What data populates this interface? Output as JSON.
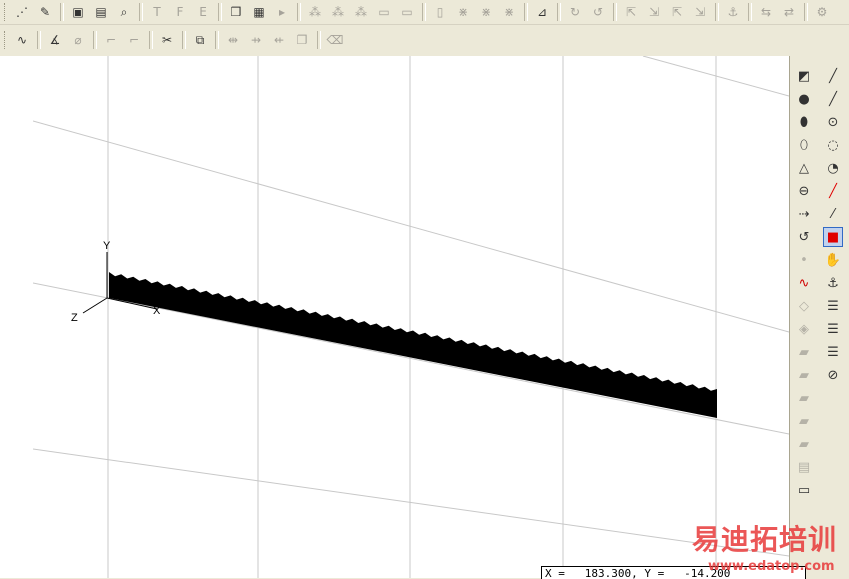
{
  "toolbar1": {
    "buttons": [
      {
        "name": "plot-icon",
        "glyph": "⋰"
      },
      {
        "name": "pin-icon",
        "glyph": "✎"
      },
      {
        "sep": true
      },
      {
        "name": "monitor-icon",
        "glyph": "▣"
      },
      {
        "name": "graph-window-icon",
        "glyph": "▤"
      },
      {
        "name": "search-doc-icon",
        "glyph": "⌕"
      },
      {
        "sep": true
      },
      {
        "name": "tool-t-icon",
        "glyph": "T",
        "dim": true
      },
      {
        "name": "tool-f-icon",
        "glyph": "F",
        "dim": true
      },
      {
        "name": "tool-e-icon",
        "glyph": "E",
        "dim": true
      },
      {
        "sep": true
      },
      {
        "name": "cube-icon",
        "glyph": "❒"
      },
      {
        "name": "save-icon",
        "glyph": "▦"
      },
      {
        "name": "play-icon",
        "glyph": "▸",
        "dim": true
      },
      {
        "sep": true
      },
      {
        "name": "node-icon-1",
        "glyph": "⁂",
        "dim": true
      },
      {
        "name": "node-icon-2",
        "glyph": "⁂",
        "dim": true
      },
      {
        "name": "node-icon-3",
        "glyph": "⁂",
        "dim": true
      },
      {
        "name": "layer-icon-1",
        "glyph": "▭",
        "dim": true
      },
      {
        "name": "layer-icon-2",
        "glyph": "▭",
        "dim": true
      },
      {
        "sep": true
      },
      {
        "name": "page-icon",
        "glyph": "▯",
        "dim": true
      },
      {
        "name": "mesh-icon-1",
        "glyph": "⋇",
        "dim": true
      },
      {
        "name": "mesh-icon-2",
        "glyph": "⋇",
        "dim": true
      },
      {
        "name": "mesh-icon-3",
        "glyph": "⋇",
        "dim": true
      },
      {
        "sep": true
      },
      {
        "name": "coordinate-icon",
        "glyph": "⊿"
      },
      {
        "sep": true
      },
      {
        "name": "rotate-icon-1",
        "glyph": "↻",
        "dim": true
      },
      {
        "name": "rotate-icon-2",
        "glyph": "↺",
        "dim": true
      },
      {
        "sep": true
      },
      {
        "name": "transform-icon-1",
        "glyph": "⇱",
        "dim": true
      },
      {
        "name": "transform-icon-2",
        "glyph": "⇲",
        "dim": true
      },
      {
        "name": "transform-icon-3",
        "glyph": "⇱",
        "dim": true
      },
      {
        "name": "transform-icon-4",
        "glyph": "⇲",
        "dim": true
      },
      {
        "sep": true
      },
      {
        "name": "anchor-small-icon",
        "glyph": "⚓",
        "dim": true
      },
      {
        "sep": true
      },
      {
        "name": "flip-icon-1",
        "glyph": "⇆",
        "dim": true
      },
      {
        "name": "flip-icon-2",
        "glyph": "⇄",
        "dim": true
      },
      {
        "sep": true
      },
      {
        "name": "settings-icon",
        "glyph": "⚙",
        "dim": true
      }
    ]
  },
  "toolbar2": {
    "buttons": [
      {
        "name": "curve-icon",
        "glyph": "∿"
      },
      {
        "sep": true
      },
      {
        "name": "angle-30-icon",
        "glyph": "∡"
      },
      {
        "name": "pipe-icon",
        "glyph": "⌀",
        "dim": true
      },
      {
        "sep": true
      },
      {
        "name": "corner-icon-1",
        "glyph": "⌐",
        "dim": true
      },
      {
        "name": "corner-icon-2",
        "glyph": "⌐",
        "dim": true
      },
      {
        "sep": true
      },
      {
        "name": "scissors-icon",
        "glyph": "✂"
      },
      {
        "sep": true
      },
      {
        "name": "boolean-icon",
        "glyph": "⧉"
      },
      {
        "sep": true
      },
      {
        "name": "mirror-icon-1",
        "glyph": "⇹",
        "dim": true
      },
      {
        "name": "mirror-icon-2",
        "glyph": "⇸",
        "dim": true
      },
      {
        "name": "mirror-icon-3",
        "glyph": "⇷",
        "dim": true
      },
      {
        "name": "copy-icon",
        "glyph": "❐",
        "dim": true
      },
      {
        "sep": true
      },
      {
        "name": "eraser-icon",
        "glyph": "⌫",
        "dim": true
      }
    ]
  },
  "palette": {
    "col1": [
      {
        "name": "plane-icon",
        "glyph": "◩"
      },
      {
        "name": "sphere-icon",
        "glyph": "●"
      },
      {
        "name": "cylinder-icon",
        "glyph": "⬮"
      },
      {
        "name": "cylinder-alt-icon",
        "glyph": "⬯"
      },
      {
        "name": "cone-icon",
        "glyph": "△"
      },
      {
        "name": "ellipse-icon",
        "glyph": "⊖"
      },
      {
        "name": "extrude-icon",
        "glyph": "⇢"
      },
      {
        "name": "revolve-icon",
        "glyph": "↺"
      },
      {
        "name": "point-icon",
        "glyph": "•",
        "dim": true
      },
      {
        "name": "curve-red-icon",
        "glyph": "∿"
      },
      {
        "name": "face-icon-1",
        "glyph": "◇",
        "dim": true
      },
      {
        "name": "face-icon-2",
        "glyph": "◈",
        "dim": true
      },
      {
        "name": "block-icon-1",
        "glyph": "▰",
        "dim": true
      },
      {
        "name": "block-icon-2",
        "glyph": "▰",
        "dim": true
      },
      {
        "name": "block-icon-3",
        "glyph": "▰",
        "dim": true
      },
      {
        "name": "block-icon-4",
        "glyph": "▰",
        "dim": true
      },
      {
        "name": "block-icon-5",
        "glyph": "▰",
        "dim": true
      },
      {
        "name": "doc-icon",
        "glyph": "▤",
        "dim": true
      },
      {
        "name": "folder-icon",
        "glyph": "▭"
      }
    ],
    "col2": [
      {
        "name": "line-icon",
        "glyph": "╱"
      },
      {
        "name": "line-point-icon",
        "glyph": "╱"
      },
      {
        "name": "circle-center-icon",
        "glyph": "⊙"
      },
      {
        "name": "circle-icon",
        "glyph": "◌"
      },
      {
        "name": "arc-icon",
        "glyph": "◔"
      },
      {
        "name": "red-line-icon",
        "glyph": "╱"
      },
      {
        "name": "xy-line-icon",
        "glyph": "⁄"
      },
      {
        "name": "red-square-icon",
        "glyph": "■",
        "selected": true
      },
      {
        "name": "hand-icon",
        "glyph": "✋"
      },
      {
        "name": "anchor-icon",
        "glyph": "⚓"
      },
      {
        "name": "list-icon-1",
        "glyph": "☰"
      },
      {
        "name": "list-icon-2",
        "glyph": "☰"
      },
      {
        "name": "list-icon-3",
        "glyph": "☰"
      },
      {
        "name": "no-entry-icon",
        "glyph": "⊘"
      }
    ]
  },
  "viewport": {
    "axis_labels": {
      "y": "Y",
      "z": "Z",
      "x": "X"
    },
    "shape_color": "#000000",
    "grid_color": "#c8c8c8"
  },
  "status": {
    "readout": "X =   183.300, Y =   -14.200"
  },
  "watermark": {
    "chinese": "易迪拓培训",
    "url": "www.edatop.com"
  }
}
